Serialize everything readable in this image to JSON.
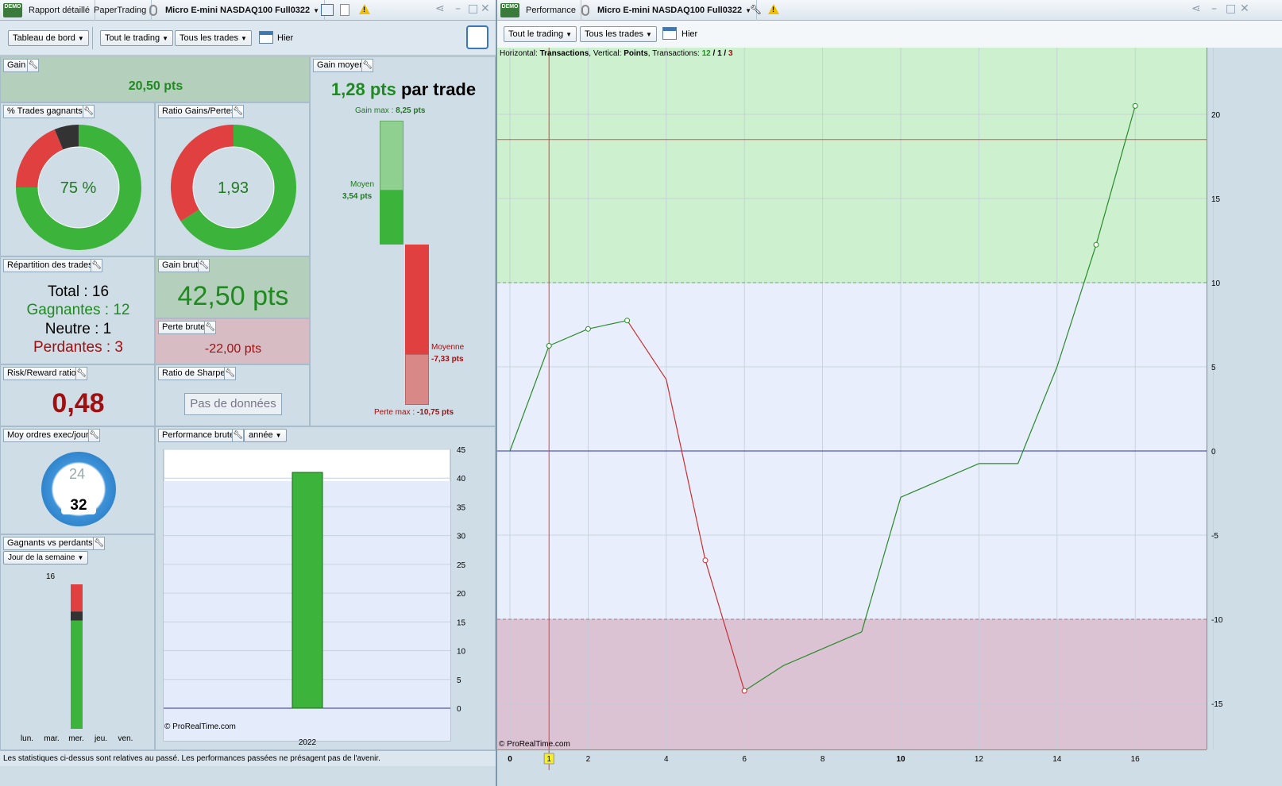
{
  "left_window": {
    "titlebar": {
      "demo_badge": "DEMO",
      "tab_report": "Rapport détaillé",
      "tab_account": "PaperTrading",
      "instrument": "Micro E-mini NASDAQ100 Full0322"
    },
    "toolbar": {
      "dashboard": "Tableau de bord",
      "scope": "Tout le trading",
      "trades": "Tous les trades",
      "period": "Hier"
    },
    "gain": {
      "title": "Gain",
      "value": "20,50 pts"
    },
    "gain_moyen": {
      "title": "Gain moyen",
      "value": "1,28 pts",
      "suffix": "par trade",
      "gain_max_label": "Gain max :",
      "gain_max_value": "8,25 pts",
      "moyen_label": "Moyen",
      "moyen_value": "3,54 pts",
      "moyenne_label": "Moyenne",
      "moyenne_value": "-7,33 pts",
      "perte_max_label": "Perte max :",
      "perte_max_value": "-10,75 pts"
    },
    "pct_trades": {
      "title": "% Trades gagnants",
      "value": "75 %",
      "win_fraction": 0.75,
      "neutral_fraction": 0.0625
    },
    "ratio": {
      "title": "Ratio Gains/Pertes",
      "value": "1,93",
      "gain_fraction": 0.659
    },
    "repartition": {
      "title": "Répartition des trades",
      "total": "Total : 16",
      "gagnantes": "Gagnantes : 12",
      "neutre": "Neutre : 1",
      "perdantes": "Perdantes : 3"
    },
    "gain_brut": {
      "title": "Gain brut",
      "value": "42,50 pts"
    },
    "perte_brute": {
      "title": "Perte brute",
      "value": "-22,00 pts"
    },
    "risk_reward": {
      "title": "Risk/Reward ratio",
      "value": "0,48"
    },
    "sharpe": {
      "title": "Ratio de Sharpe",
      "button": "Pas de données"
    },
    "moy_ordres": {
      "title": "Moy ordres exec/jour",
      "clock_label": "24",
      "value": "32"
    },
    "perf_brute": {
      "title": "Performance brute",
      "period": "année",
      "watermark": "© ProRealTime.com"
    },
    "gagnants_vs": {
      "title": "Gagnants vs perdants",
      "selector": "Jour de la semaine",
      "count": "16",
      "days": [
        "lun.",
        "mar.",
        "mer.",
        "jeu.",
        "ven."
      ]
    },
    "status_bar": "Les statistiques ci-dessus sont relatives au passé. Les performances passées ne présagent pas de l'avenir."
  },
  "right_window": {
    "titlebar": {
      "demo_badge": "DEMO",
      "tab_perf": "Performance",
      "instrument": "Micro E-mini NASDAQ100 Full0322"
    },
    "toolbar": {
      "scope": "Tout le trading",
      "trades": "Tous les trades",
      "period": "Hier"
    },
    "info": {
      "h_label": "Horizontal:",
      "h_value": "Transactions",
      "v_label": "Vertical:",
      "v_value": "Points",
      "t_label": "Transactions:",
      "t_win": "12",
      "t_sep1": "/",
      "t_neutral": "1",
      "t_sep2": "/",
      "t_loss": "3"
    },
    "watermark": "© ProRealTime.com",
    "cursor_label": "1"
  },
  "chart_data": [
    {
      "type": "bar",
      "categories": [
        "2022"
      ],
      "values": [
        41
      ],
      "ylim": [
        0,
        45
      ],
      "yticks": [
        0,
        5,
        10,
        15,
        20,
        25,
        30,
        35,
        40,
        45
      ],
      "colors": {
        "bar": "#3cb43c"
      }
    },
    {
      "type": "bar",
      "categories": [
        "lun.",
        "mar.",
        "mer.",
        "jeu.",
        "ven."
      ],
      "series": [
        {
          "values": [
            0,
            12,
            0,
            0,
            0
          ],
          "color": "#3cb43c"
        },
        {
          "values": [
            0,
            1,
            0,
            0,
            0
          ],
          "color": "#333333"
        },
        {
          "values": [
            0,
            3,
            0,
            0,
            0
          ],
          "color": "#e04040"
        }
      ],
      "ylim": [
        0,
        16
      ]
    },
    {
      "type": "line",
      "x": [
        0,
        1,
        2,
        3,
        4,
        5,
        6,
        7,
        8,
        9,
        10,
        11,
        12,
        13,
        14,
        15,
        16
      ],
      "y": [
        0,
        6.25,
        7.25,
        7.75,
        4.25,
        -6.5,
        -14.25,
        -12.75,
        -11.75,
        -10.75,
        -2.75,
        -1.75,
        -0.75,
        -0.75,
        5,
        12.25,
        20.5
      ],
      "xlim": [
        0,
        17.9
      ],
      "ylim": [
        -17.5,
        24.5
      ],
      "xticks": [
        0,
        2,
        4,
        6,
        8,
        10,
        12,
        14,
        16
      ],
      "yticks": [
        -15,
        -10,
        -5,
        0,
        5,
        10,
        15,
        20
      ],
      "upper_zone": 10,
      "lower_zone": -10,
      "max_gain_line": 18.5,
      "cursor_x": 1,
      "colors": {
        "up": "#2a8a2a",
        "down": "#c83030",
        "zero": "#3030c0"
      }
    }
  ]
}
